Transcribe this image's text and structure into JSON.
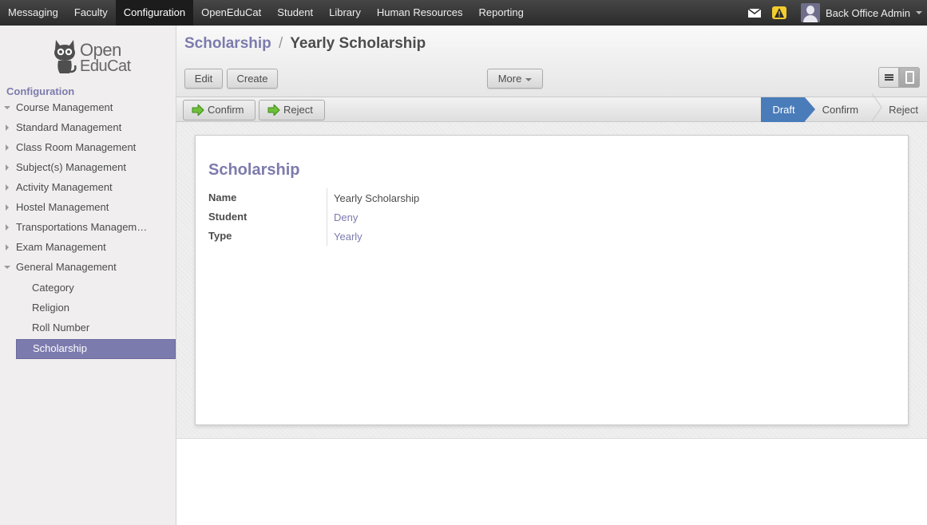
{
  "topbar": {
    "menu": [
      "Messaging",
      "Faculty",
      "Configuration",
      "OpenEduCat",
      "Student",
      "Library",
      "Human Resources",
      "Reporting"
    ],
    "active_menu": "Configuration",
    "user_name": "Back Office Admin"
  },
  "sidebar": {
    "logo_line1": "Open",
    "logo_line2": "EduCat",
    "heading": "Configuration",
    "items": [
      {
        "label": "Course Management",
        "open": true
      },
      {
        "label": "Standard Management"
      },
      {
        "label": "Class Room Management"
      },
      {
        "label": "Subject(s) Management"
      },
      {
        "label": "Activity Management"
      },
      {
        "label": "Hostel Management"
      },
      {
        "label": "Transportations Managem…"
      },
      {
        "label": "Exam Management"
      },
      {
        "label": "General Management",
        "open": true
      }
    ],
    "sub_items": [
      "Category",
      "Religion",
      "Roll Number",
      "Scholarship"
    ],
    "active_sub": "Scholarship"
  },
  "header": {
    "breadcrumb_parent": "Scholarship",
    "breadcrumb_sep": "/",
    "breadcrumb_current": "Yearly Scholarship",
    "edit_label": "Edit",
    "create_label": "Create",
    "more_label": "More"
  },
  "statusbar": {
    "confirm_label": "Confirm",
    "reject_label": "Reject",
    "stages": [
      "Draft",
      "Confirm",
      "Reject"
    ],
    "active_stage": "Draft"
  },
  "form": {
    "title": "Scholarship",
    "fields": [
      {
        "label": "Name",
        "value": "Yearly Scholarship",
        "link": false
      },
      {
        "label": "Student",
        "value": "Deny",
        "link": true
      },
      {
        "label": "Type",
        "value": "Yearly",
        "link": true
      }
    ]
  },
  "colors": {
    "accent": "#7c7bad",
    "active_stage": "#4a7cba",
    "topbar": "#2b2b2b"
  }
}
